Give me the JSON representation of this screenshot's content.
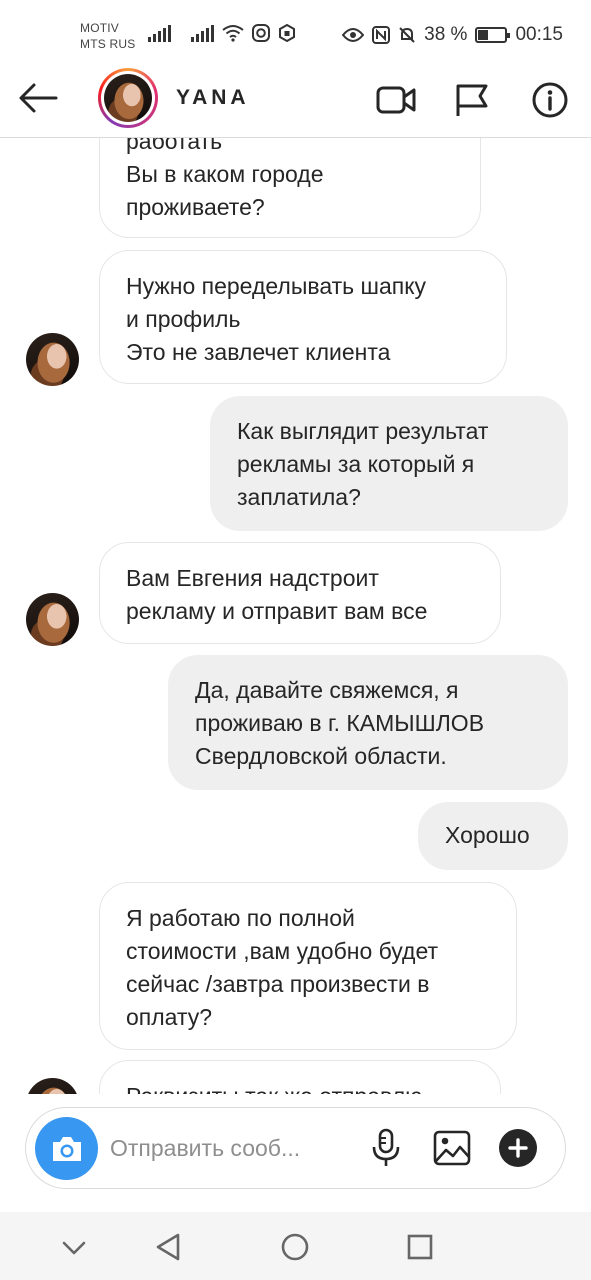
{
  "status_bar": {
    "carrier_line1": "MOTIV",
    "carrier_line2": "MTS RUS",
    "battery_text": "38 %",
    "battery_level": 0.38,
    "time": "00:15",
    "icons": [
      "signal-icon",
      "signal-icon",
      "wifi-icon",
      "instagram-icon",
      "vpn-icon",
      "eye-icon",
      "nfc-icon",
      "mute-bell-icon",
      "battery-icon"
    ]
  },
  "header": {
    "title": "YANA",
    "icons": [
      "back-arrow-icon",
      "video-call-icon",
      "flag-icon",
      "info-icon"
    ]
  },
  "messages": [
    {
      "side": "in",
      "text": "работать\nВы в каком городе\nпроживаете?",
      "avatar": false
    },
    {
      "side": "in",
      "text": "Нужно переделывать шапку\nи профиль\nЭто не завлечет клиента",
      "avatar": true
    },
    {
      "side": "out",
      "text": "Как выглядит результат\nрекламы за который я\nзаплатила?"
    },
    {
      "side": "in",
      "text": "Вам Евгения надстроит\nрекламу и отправит вам все",
      "avatar": true
    },
    {
      "side": "out",
      "text": "Да, давайте свяжемся, я\nпроживаю в г. КАМЫШЛОВ\nСвердловской области."
    },
    {
      "side": "out",
      "text": "Хорошо"
    },
    {
      "side": "in",
      "text": "Я работаю по полной\nстоимости ,вам удобно будет\nсейчас /завтра произвести в\nоплату?",
      "avatar": false
    },
    {
      "side": "in",
      "text": "Реквизиты так же отправлю",
      "avatar": true
    }
  ],
  "composer": {
    "placeholder": "Отправить сооб...",
    "icons": [
      "camera-icon",
      "microphone-icon",
      "gallery-icon",
      "plus-icon"
    ]
  },
  "navbar": {
    "icons": [
      "chevron-down-icon",
      "back-triangle-icon",
      "home-circle-icon",
      "recents-square-icon"
    ]
  },
  "colors": {
    "accent": "#3897f0",
    "outgoing_bubble": "#efefef",
    "incoming_border": "#e6e6e6",
    "text": "#262626"
  }
}
